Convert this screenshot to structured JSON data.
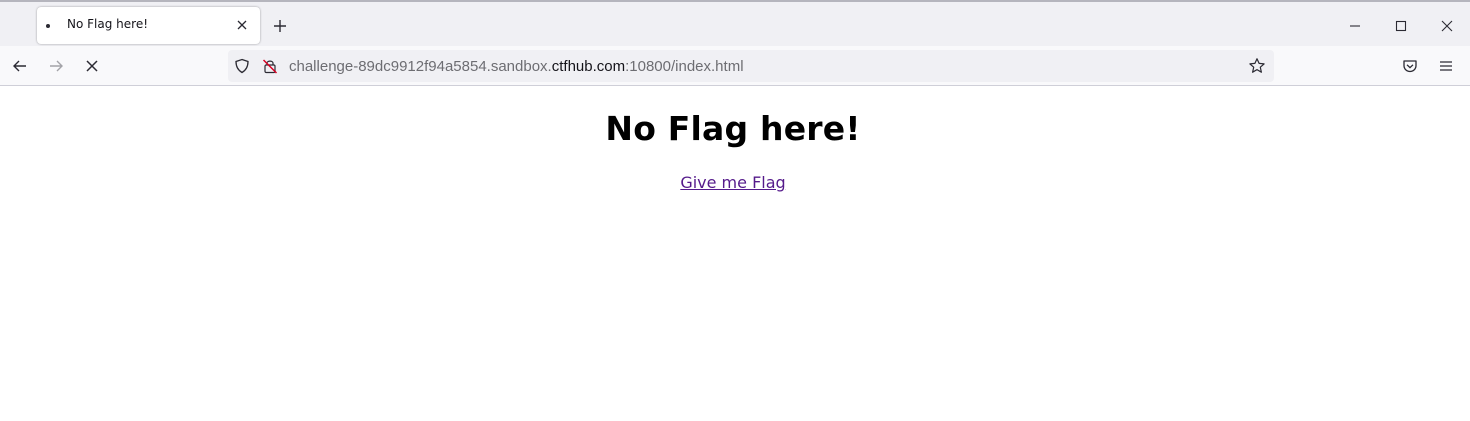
{
  "browser": {
    "tab": {
      "title": "No Flag here!",
      "icons": {
        "favicon": "bullet-dot-icon",
        "close": "close-icon"
      }
    },
    "new_tab_icon": "plus-icon",
    "window_controls": [
      "minimize-icon",
      "maximize-icon",
      "close-icon"
    ],
    "nav": {
      "back_icon": "arrow-left-icon",
      "forward_icon": "arrow-right-icon",
      "stop_icon": "stop-x-icon"
    },
    "urlbar": {
      "prefix": "challenge-89dc9912f94a5854.sandbox.",
      "domain": "ctfhub.com",
      "suffix": ":10800/index.html",
      "icons": [
        "shield-icon",
        "insecure-lock-icon",
        "bookmark-star-icon"
      ]
    },
    "toolbar_right_icons": [
      "pocket-icon",
      "hamburger-menu-icon"
    ]
  },
  "page": {
    "heading": "No Flag here!",
    "link_text": "Give me Flag"
  },
  "colors": {
    "link_visited": "#551a8b",
    "tabstrip_bg": "#f0f0f4",
    "urlbar_bg": "#f0f0f4",
    "insecure_lock": "#d70022"
  }
}
